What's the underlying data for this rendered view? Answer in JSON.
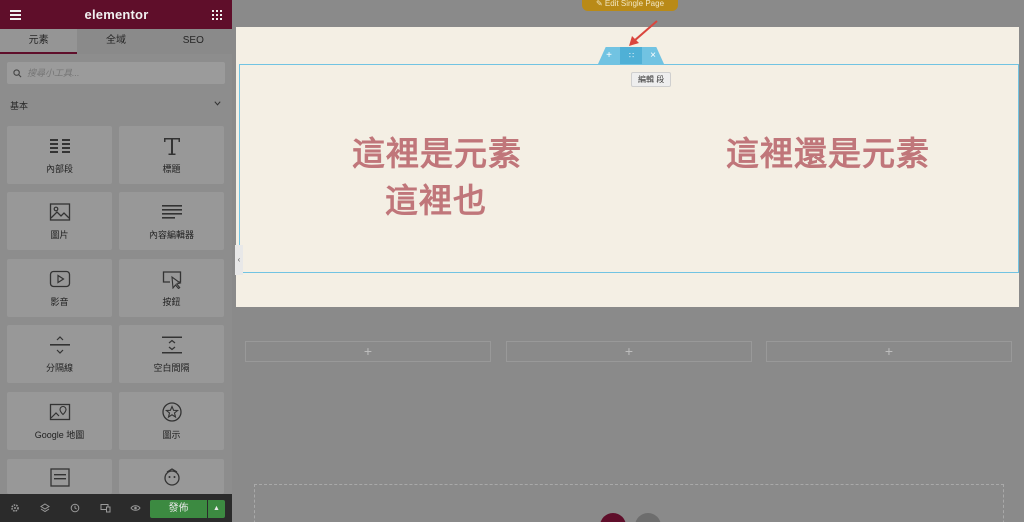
{
  "app": {
    "logo": "elementor",
    "menu_icon": "hamburger-icon",
    "apps_icon": "grid-icon"
  },
  "tabs": [
    {
      "label": "元素",
      "active": true
    },
    {
      "label": "全域",
      "active": false
    },
    {
      "label": "SEO",
      "active": false
    }
  ],
  "search": {
    "placeholder": "搜尋小工具...",
    "icon": "search-icon"
  },
  "category": {
    "label": "基本",
    "icon": "chevron-down-icon"
  },
  "widgets": [
    {
      "label": "內部段",
      "icon": "inner-section-icon"
    },
    {
      "label": "標題",
      "icon": "heading-icon"
    },
    {
      "label": "圖片",
      "icon": "image-icon"
    },
    {
      "label": "內容編輯器",
      "icon": "text-editor-icon"
    },
    {
      "label": "影音",
      "icon": "video-icon"
    },
    {
      "label": "按鈕",
      "icon": "button-icon"
    },
    {
      "label": "分隔線",
      "icon": "divider-icon"
    },
    {
      "label": "空白間隔",
      "icon": "spacer-icon"
    },
    {
      "label": "Google 地圖",
      "icon": "map-icon"
    },
    {
      "label": "圖示",
      "icon": "star-icon"
    },
    {
      "label": "",
      "icon": "template-icon"
    },
    {
      "label": "",
      "icon": "widget-icon"
    }
  ],
  "bottombar": {
    "icons": [
      "settings-icon",
      "layers-icon",
      "history-icon",
      "responsive-icon",
      "preview-icon"
    ],
    "publish_label": "發佈",
    "publish_more_icon": "caret-up-icon"
  },
  "canvas": {
    "edit_page_label": "✎ Edit Single Page",
    "handles": {
      "add": "+",
      "move": "∷",
      "close": "×"
    },
    "tooltip": "編輯 段",
    "column1_line1": "這裡是元素",
    "column1_line2": "這裡也",
    "column2_line1": "這裡還是元素",
    "add_columns": [
      "+",
      "+",
      "+"
    ]
  },
  "colors": {
    "brand": "#5f0e2a",
    "publish": "#3c8a41",
    "handle": "#71c3e2",
    "heading": "#c0767a"
  }
}
